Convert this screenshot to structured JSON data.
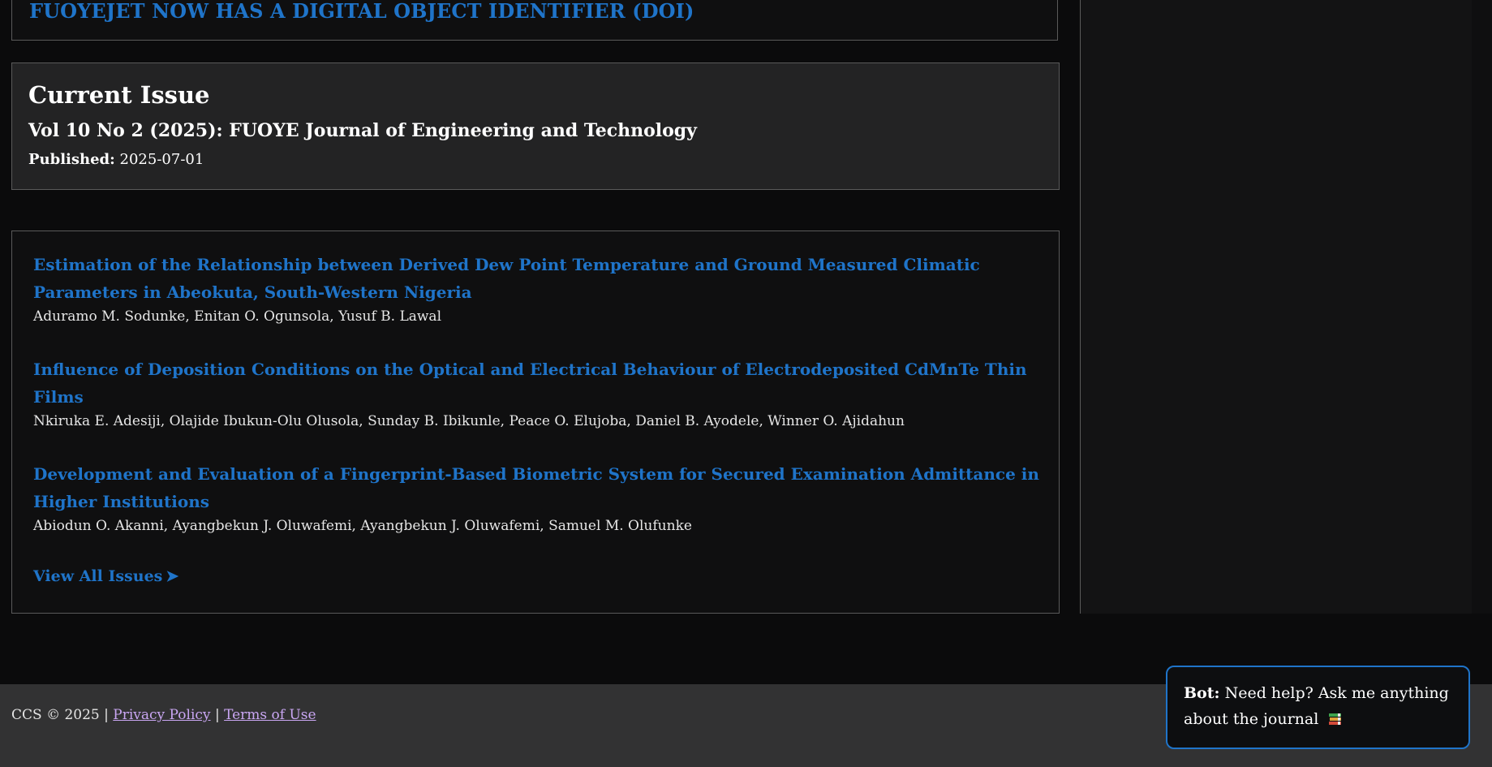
{
  "announcement": {
    "link_text": "FUOYEJET NOW HAS A DIGITAL OBJECT IDENTIFIER (DOI)"
  },
  "current_issue": {
    "heading": "Current Issue",
    "volume": "Vol 10 No 2 (2025): FUOYE Journal of Engineering and Technology",
    "published_label": "Published:",
    "published_date": "2025-07-01"
  },
  "articles": [
    {
      "title": "Estimation of the Relationship between Derived Dew Point Temperature and Ground Measured Climatic Parameters in Abeokuta, South-Western Nigeria",
      "authors": "Aduramo M. Sodunke, Enitan O. Ogunsola, Yusuf B. Lawal"
    },
    {
      "title": "Influence of Deposition Conditions on the Optical and Electrical Behaviour of Electrodeposited CdMnTe Thin Films",
      "authors": "Nkiruka E. Adesiji, Olajide Ibukun-Olu Olusola, Sunday B. Ibikunle, Peace O. Elujoba, Daniel B. Ayodele, Winner O. Ajidahun"
    },
    {
      "title": "Development and Evaluation of a Fingerprint-Based Biometric System for Secured Examination Admittance in Higher Institutions",
      "authors": "Abiodun O. Akanni, Ayangbekun J. Oluwafemi, Ayangbekun J. Oluwafemi, Samuel M. Olufunke"
    }
  ],
  "view_all": {
    "label": "View All Issues",
    "arrow": "➤"
  },
  "footer": {
    "copyright": "CCS © 2025 |",
    "privacy_link": "Privacy Policy",
    "separator": "|",
    "terms_link": "Terms of Use"
  },
  "chatbot": {
    "speaker": "Bot:",
    "message": "Need help? Ask me anything about the journal",
    "icon": "books-icon"
  },
  "colors": {
    "link_blue": "#1f74c9",
    "footer_link": "#c9a6f2",
    "background": "#0b0b0c",
    "issue_box_bg": "#232324"
  }
}
